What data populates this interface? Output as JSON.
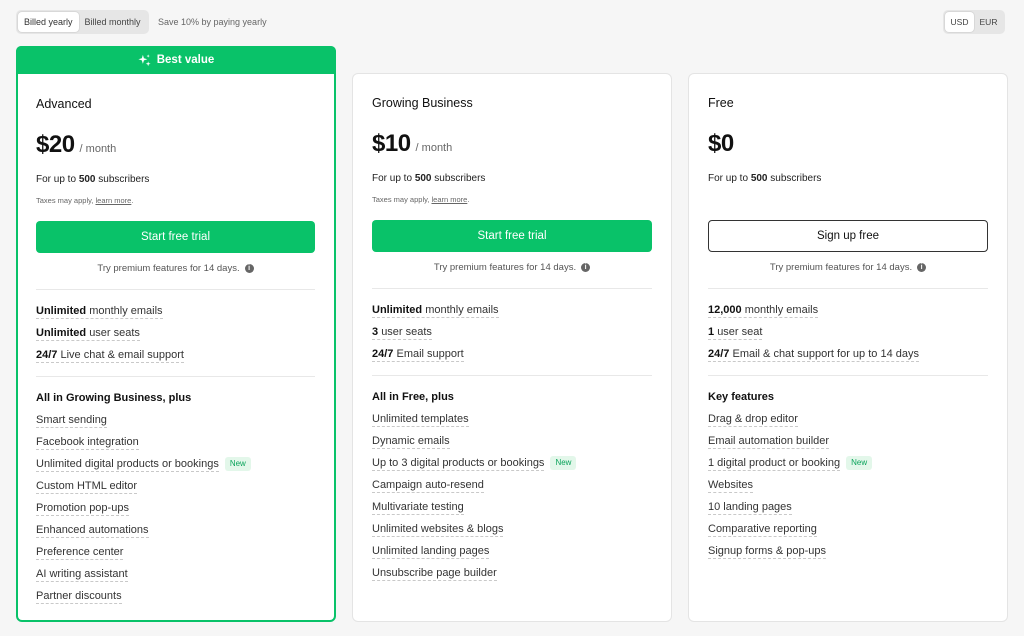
{
  "billing": {
    "yearly_label": "Billed yearly",
    "monthly_label": "Billed monthly",
    "save_note": "Save 10% by paying yearly"
  },
  "currency": {
    "usd": "USD",
    "eur": "EUR"
  },
  "plans": [
    {
      "ribbon": "Best value",
      "name": "Advanced",
      "price": "$20",
      "period": "/ month",
      "subs_prefix": "For up to",
      "subs_count": "500",
      "subs_suffix": "subscribers",
      "tax_text": "Taxes may apply,",
      "tax_link": "learn more",
      "tax_end": ".",
      "cta": "Start free trial",
      "trial_note": "Try premium features for 14 days.",
      "limits": [
        {
          "bold": "Unlimited",
          "text": "monthly emails"
        },
        {
          "bold": "Unlimited",
          "text": "user seats"
        },
        {
          "bold": "24/7",
          "text": "Live chat & email support"
        }
      ],
      "features_title": "All in Growing Business, plus",
      "features": [
        {
          "text": "Smart sending"
        },
        {
          "text": "Facebook integration"
        },
        {
          "text": "Unlimited digital products or bookings",
          "badge": "New"
        },
        {
          "text": "Custom HTML editor"
        },
        {
          "text": "Promotion pop-ups"
        },
        {
          "text": "Enhanced automations"
        },
        {
          "text": "Preference center"
        },
        {
          "text": "AI writing assistant"
        },
        {
          "text": "Partner discounts"
        }
      ]
    },
    {
      "name": "Growing Business",
      "price": "$10",
      "period": "/ month",
      "subs_prefix": "For up to",
      "subs_count": "500",
      "subs_suffix": "subscribers",
      "tax_text": "Taxes may apply,",
      "tax_link": "learn more",
      "tax_end": ".",
      "cta": "Start free trial",
      "trial_note": "Try premium features for 14 days.",
      "limits": [
        {
          "bold": "Unlimited",
          "text": "monthly emails"
        },
        {
          "bold": "3",
          "text": "user seats"
        },
        {
          "bold": "24/7",
          "text": "Email support"
        }
      ],
      "features_title": "All in Free, plus",
      "features": [
        {
          "text": "Unlimited templates"
        },
        {
          "text": "Dynamic emails"
        },
        {
          "text": "Up to 3 digital products or bookings",
          "badge": "New"
        },
        {
          "text": "Campaign auto-resend"
        },
        {
          "text": "Multivariate testing"
        },
        {
          "text": "Unlimited websites & blogs"
        },
        {
          "text": "Unlimited landing pages"
        },
        {
          "text": "Unsubscribe page builder"
        }
      ]
    },
    {
      "name": "Free",
      "price": "$0",
      "subs_prefix": "For up to",
      "subs_count": "500",
      "subs_suffix": "subscribers",
      "cta": "Sign up free",
      "trial_note": "Try premium features for 14 days.",
      "limits": [
        {
          "bold": "12,000",
          "text": "monthly emails"
        },
        {
          "bold": "1",
          "text": "user seat"
        },
        {
          "bold": "24/7",
          "text": "Email & chat support for up to 14 days"
        }
      ],
      "features_title": "Key features",
      "features": [
        {
          "text": "Drag & drop editor"
        },
        {
          "text": "Email automation builder"
        },
        {
          "text": "1 digital product or booking",
          "badge": "New"
        },
        {
          "text": "Websites"
        },
        {
          "text": "10 landing pages"
        },
        {
          "text": "Comparative reporting"
        },
        {
          "text": "Signup forms & pop-ups"
        }
      ]
    }
  ],
  "colors": {
    "accent": "#09c269",
    "badge_bg": "#e3f7ea",
    "page_bg": "#f6f6f6"
  },
  "icons": {
    "ribbon": "sparkle-icon",
    "info": "info-icon"
  }
}
